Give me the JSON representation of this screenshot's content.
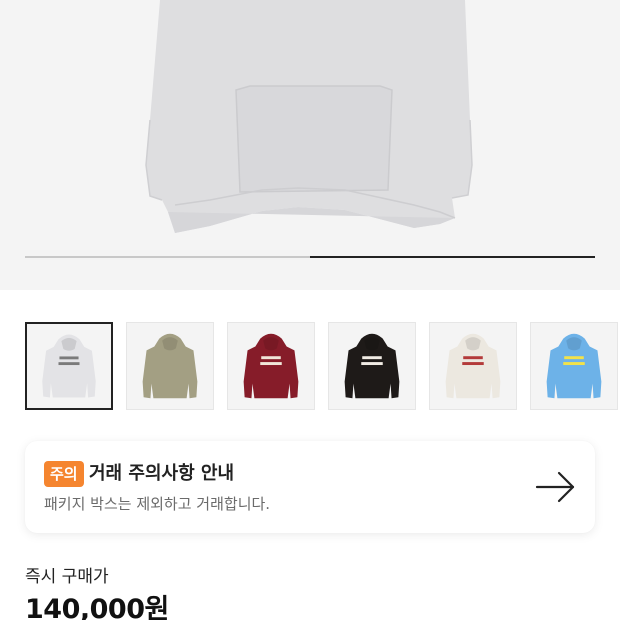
{
  "hero": {
    "image_icon": "hoodie-photo",
    "slide_progress": 0.5
  },
  "thumbnails": [
    {
      "icon": "hoodie-grey-thumb",
      "color": "#e3e3e6",
      "print_color": "#7a7a7a",
      "selected": true
    },
    {
      "icon": "hoodie-khaki-thumb",
      "color": "#a39f83",
      "print_color": "",
      "selected": false
    },
    {
      "icon": "hoodie-burgundy-thumb",
      "color": "#861c29",
      "print_color": "#f1e6d9",
      "selected": false
    },
    {
      "icon": "hoodie-black-thumb",
      "color": "#1e1a18",
      "print_color": "#f1ece4",
      "selected": false
    },
    {
      "icon": "hoodie-cream-thumb",
      "color": "#ece8e0",
      "print_color": "#b33a3a",
      "selected": false
    },
    {
      "icon": "hoodie-skyblue-thumb",
      "color": "#6db2e8",
      "print_color": "#f2e24a",
      "selected": false
    }
  ],
  "notice": {
    "badge": "주의",
    "badge_color": "#f5852f",
    "title": "거래 주의사항 안내",
    "subtitle": "패키지 박스는 제외하고 거래합니다.",
    "arrow_icon": "arrow-right-icon"
  },
  "price": {
    "label": "즉시 구매가",
    "value": "140,000원"
  }
}
